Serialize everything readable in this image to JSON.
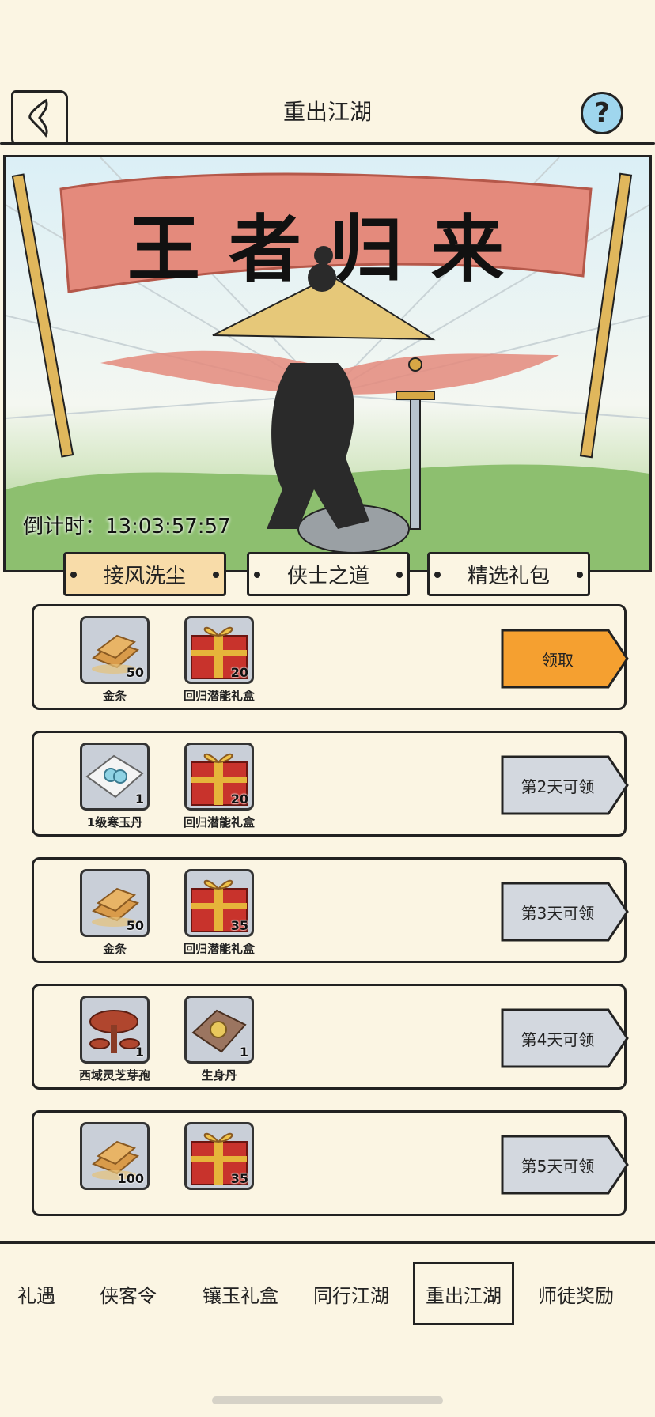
{
  "header": {
    "title": "重出江湖",
    "help_label": "?"
  },
  "banner": {
    "slogan": "王者归来",
    "countdown_label": "倒计时：",
    "countdown_value": "13:03:57:57"
  },
  "tabs": [
    {
      "label": "接风洗尘",
      "active": true
    },
    {
      "label": "侠士之道",
      "active": false
    },
    {
      "label": "精选礼包",
      "active": false
    }
  ],
  "rewards": [
    {
      "items": [
        {
          "name": "金条",
          "count": "50",
          "icon": "gold-bar-icon"
        },
        {
          "name": "回归潜能礼盒",
          "count": "20",
          "icon": "gift-box-icon"
        }
      ],
      "button": "领取",
      "claimable": true
    },
    {
      "items": [
        {
          "name": "1级寒玉丹",
          "count": "1",
          "icon": "jade-pill-icon"
        },
        {
          "name": "回归潜能礼盒",
          "count": "20",
          "icon": "gift-box-icon"
        }
      ],
      "button": "第2天可领",
      "claimable": false
    },
    {
      "items": [
        {
          "name": "金条",
          "count": "50",
          "icon": "gold-bar-icon"
        },
        {
          "name": "回归潜能礼盒",
          "count": "35",
          "icon": "gift-box-icon"
        }
      ],
      "button": "第3天可领",
      "claimable": false
    },
    {
      "items": [
        {
          "name": "西域灵芝芽孢",
          "count": "1",
          "icon": "lingzhi-icon"
        },
        {
          "name": "生身丹",
          "count": "1",
          "icon": "pill-icon"
        }
      ],
      "button": "第4天可领",
      "claimable": false
    },
    {
      "items": [
        {
          "name": "",
          "count": "100",
          "icon": "gold-bar-icon"
        },
        {
          "name": "",
          "count": "35",
          "icon": "gift-box-icon"
        }
      ],
      "button": "第5天可领",
      "claimable": false
    }
  ],
  "nav": [
    {
      "label": "礼遇",
      "active": false
    },
    {
      "label": "侠客令",
      "active": false
    },
    {
      "label": "镶玉礼盒",
      "active": false
    },
    {
      "label": "同行江湖",
      "active": false
    },
    {
      "label": "重出江湖",
      "active": true
    },
    {
      "label": "师徒奖励",
      "active": false
    }
  ],
  "colors": {
    "background": "#fbf5e3",
    "claim_button": "#f5a030",
    "locked_button": "#d3d8df",
    "banner_flag": "#e48a7c",
    "active_tab": "#f8dca9"
  }
}
